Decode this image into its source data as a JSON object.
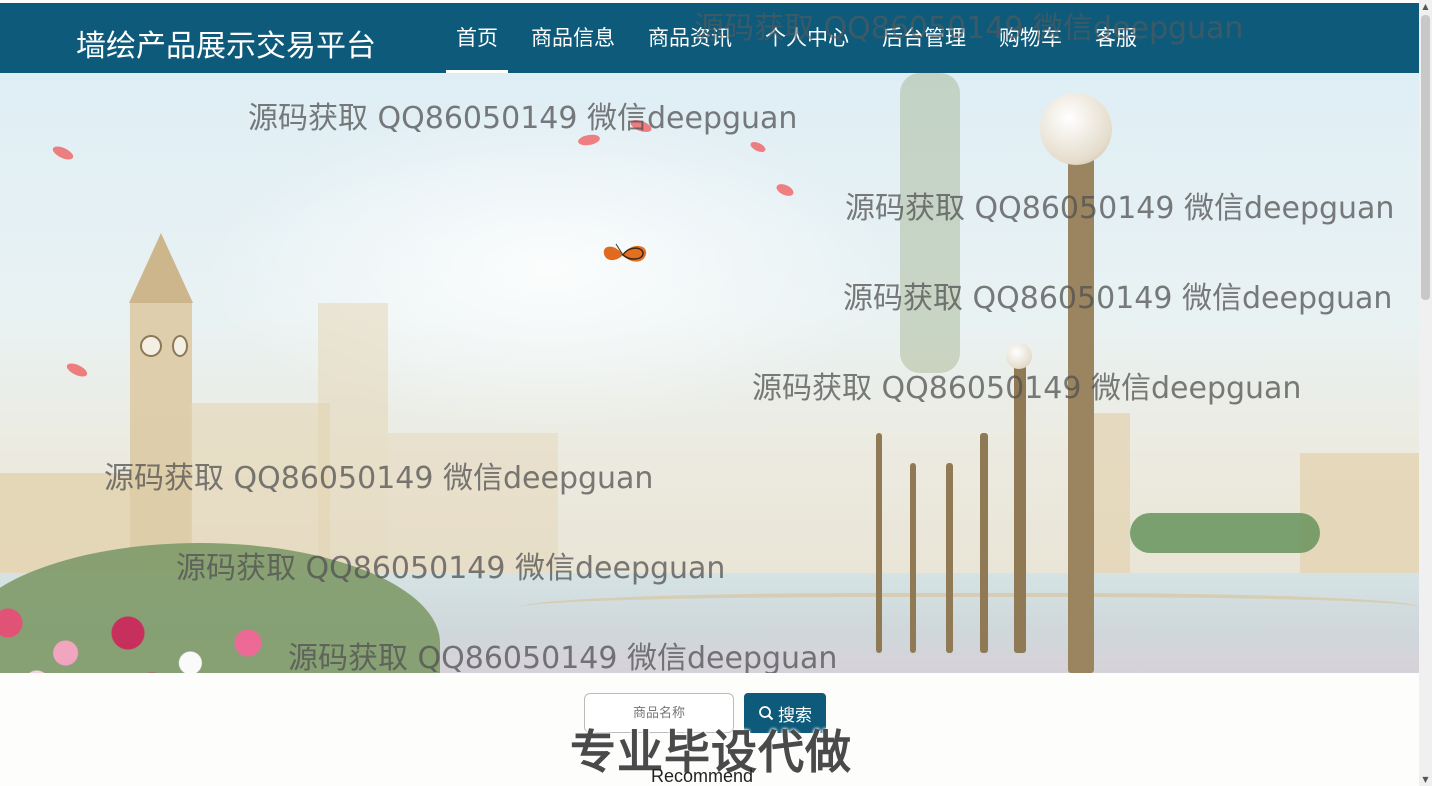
{
  "brand": {
    "title": "墙绘产品展示交易平台"
  },
  "nav": {
    "items": [
      {
        "label": "首页",
        "active": true
      },
      {
        "label": "商品信息",
        "active": false
      },
      {
        "label": "商品资讯",
        "active": false
      },
      {
        "label": "个人中心",
        "active": false
      },
      {
        "label": "后台管理",
        "active": false
      },
      {
        "label": "购物车",
        "active": false
      },
      {
        "label": "客服",
        "active": false
      }
    ]
  },
  "watermarks": [
    "源码获取 QQ86050149 微信deepguan",
    "源码获取 QQ86050149 微信deepguan",
    "源码获取 QQ86050149 微信deepguan",
    "源码获取 QQ86050149 微信deepguan",
    "源码获取 QQ86050149 微信deepguan",
    "源码获取 QQ86050149 微信deepguan",
    "源码获取 QQ86050149 微信deepguan",
    "源码获取 QQ86050149 微信deepguan"
  ],
  "search": {
    "placeholder": "商品名称",
    "button_label": "搜索",
    "button_icon": "search-icon"
  },
  "overlay_banner": "专业毕设代做",
  "section": {
    "recommend_label": "Recommend"
  },
  "colors": {
    "navbar": "#0e5a7a",
    "button": "#0e5a7a"
  }
}
